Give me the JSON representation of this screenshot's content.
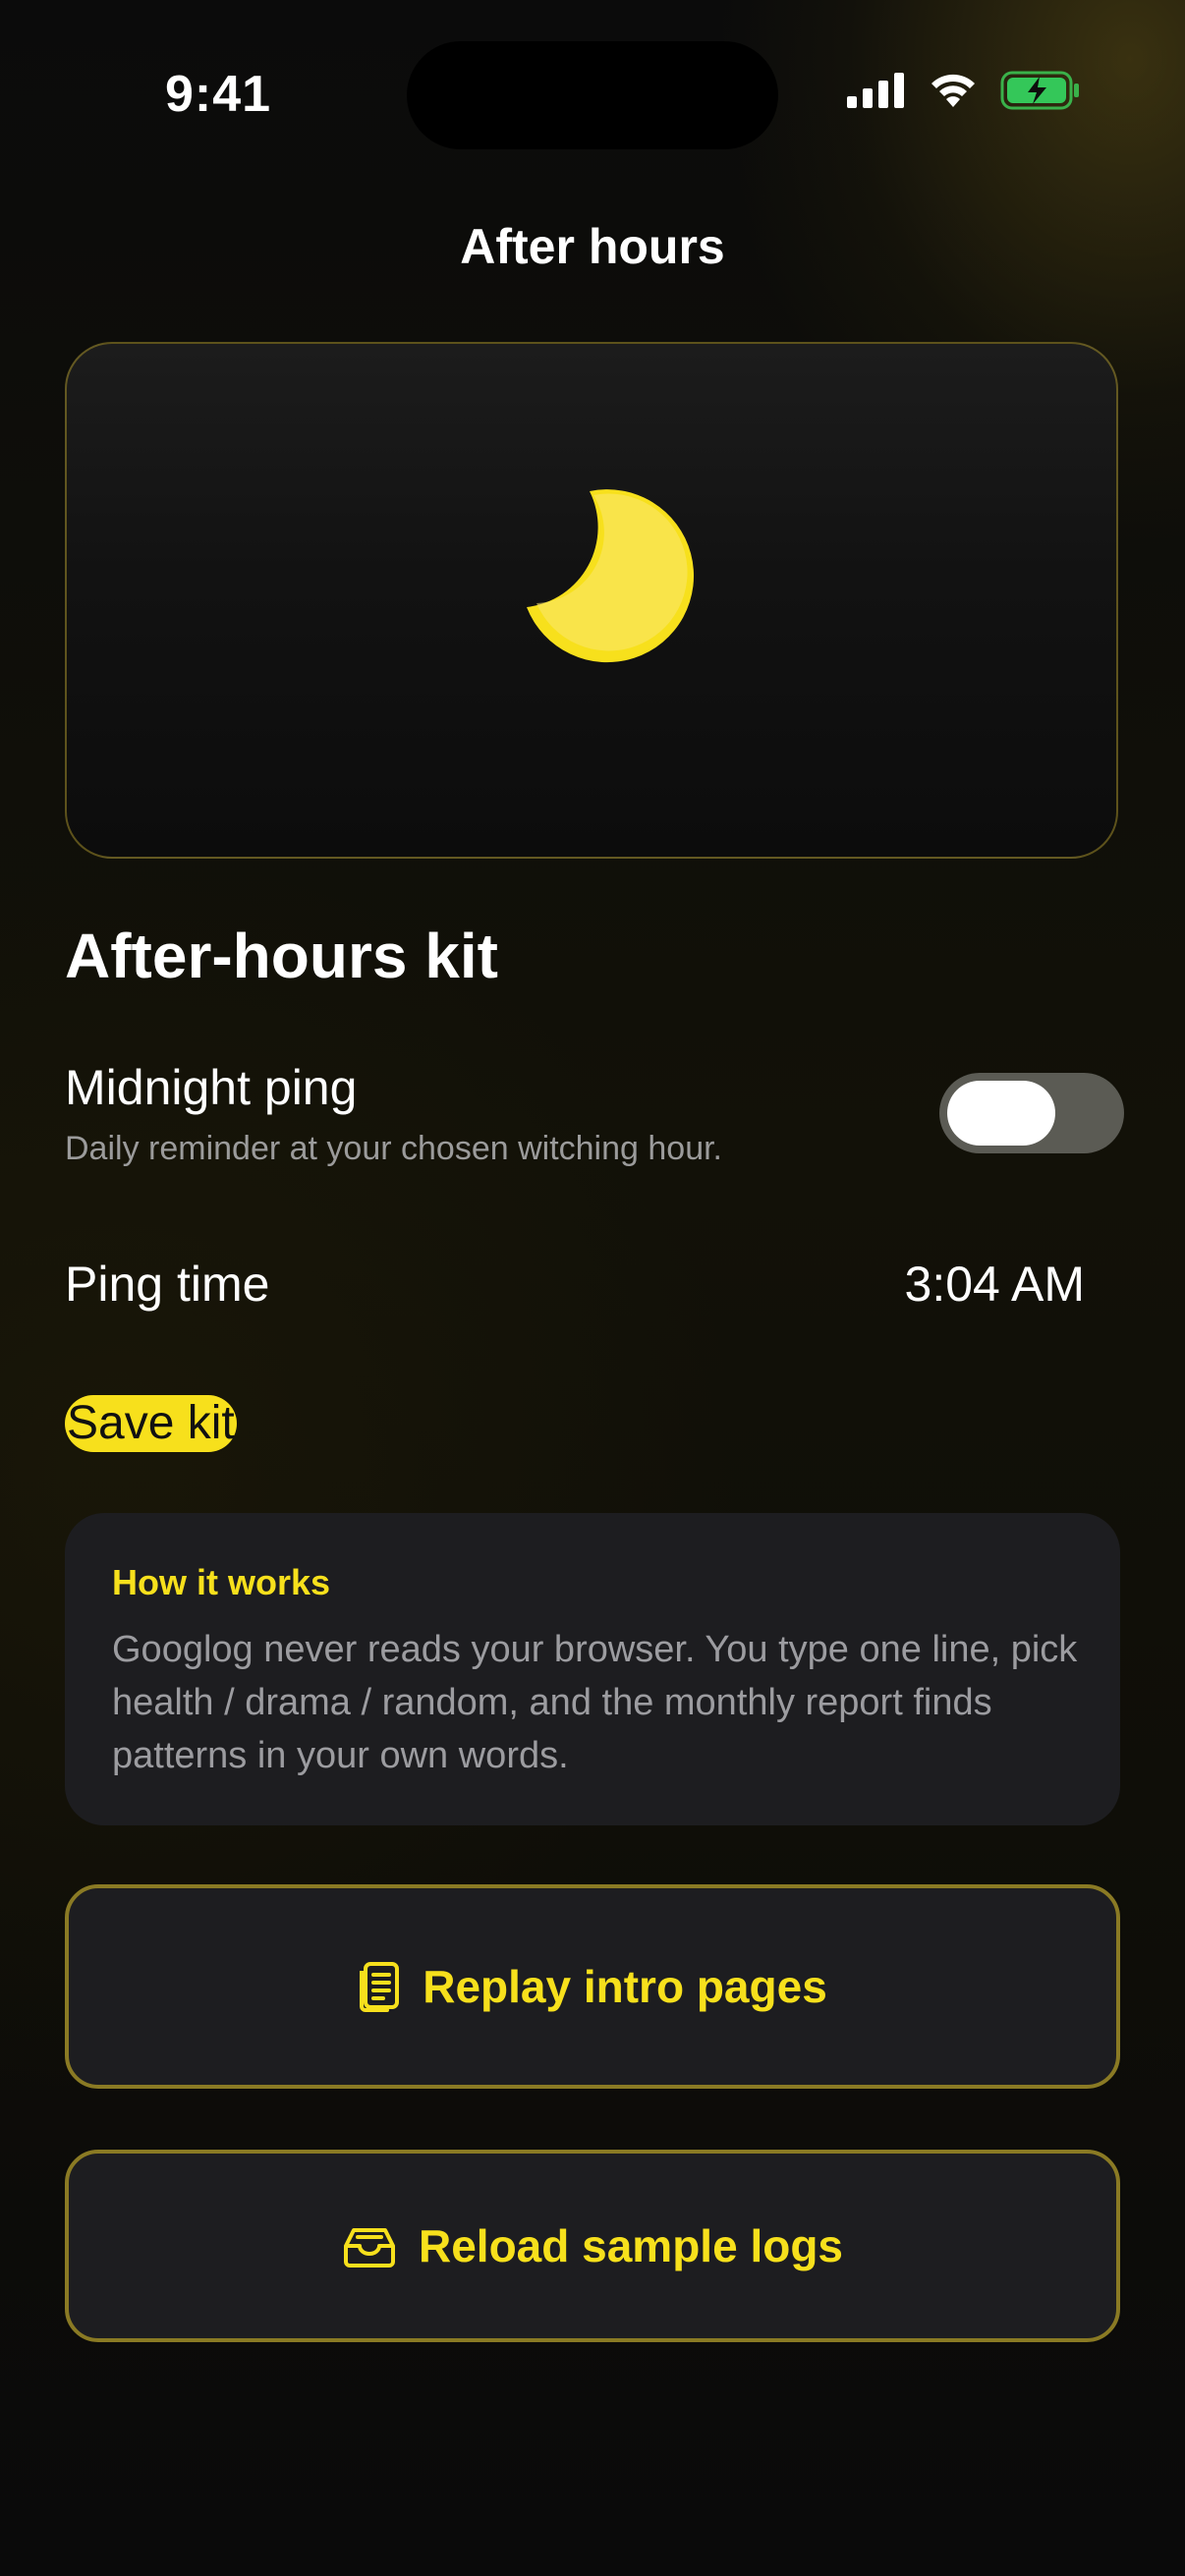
{
  "status_bar": {
    "time": "9:41"
  },
  "nav": {
    "title": "After hours"
  },
  "hero": {
    "icon": "crescent-moon-icon",
    "accent": "#f7e01c"
  },
  "kit": {
    "title": "After-hours kit",
    "midnight_ping": {
      "label": "Midnight ping",
      "subtitle": "Daily reminder at your chosen witching hour.",
      "enabled": false
    },
    "ping_time": {
      "label": "Ping time",
      "value": "3:04 AM"
    },
    "save_label": "Save kit"
  },
  "info": {
    "title": "How it works",
    "body": "Googlog never reads your browser. You type one line, pick health / drama / random, and the monthly report finds patterns in your own words."
  },
  "actions": {
    "replay": {
      "label": "Replay intro pages",
      "icon": "document-icon"
    },
    "reload": {
      "label": "Reload sample logs",
      "icon": "inbox-tray-icon"
    }
  },
  "colors": {
    "accent": "#f7e01c",
    "background": "#0d0d0c",
    "card": "#1d1d20"
  }
}
